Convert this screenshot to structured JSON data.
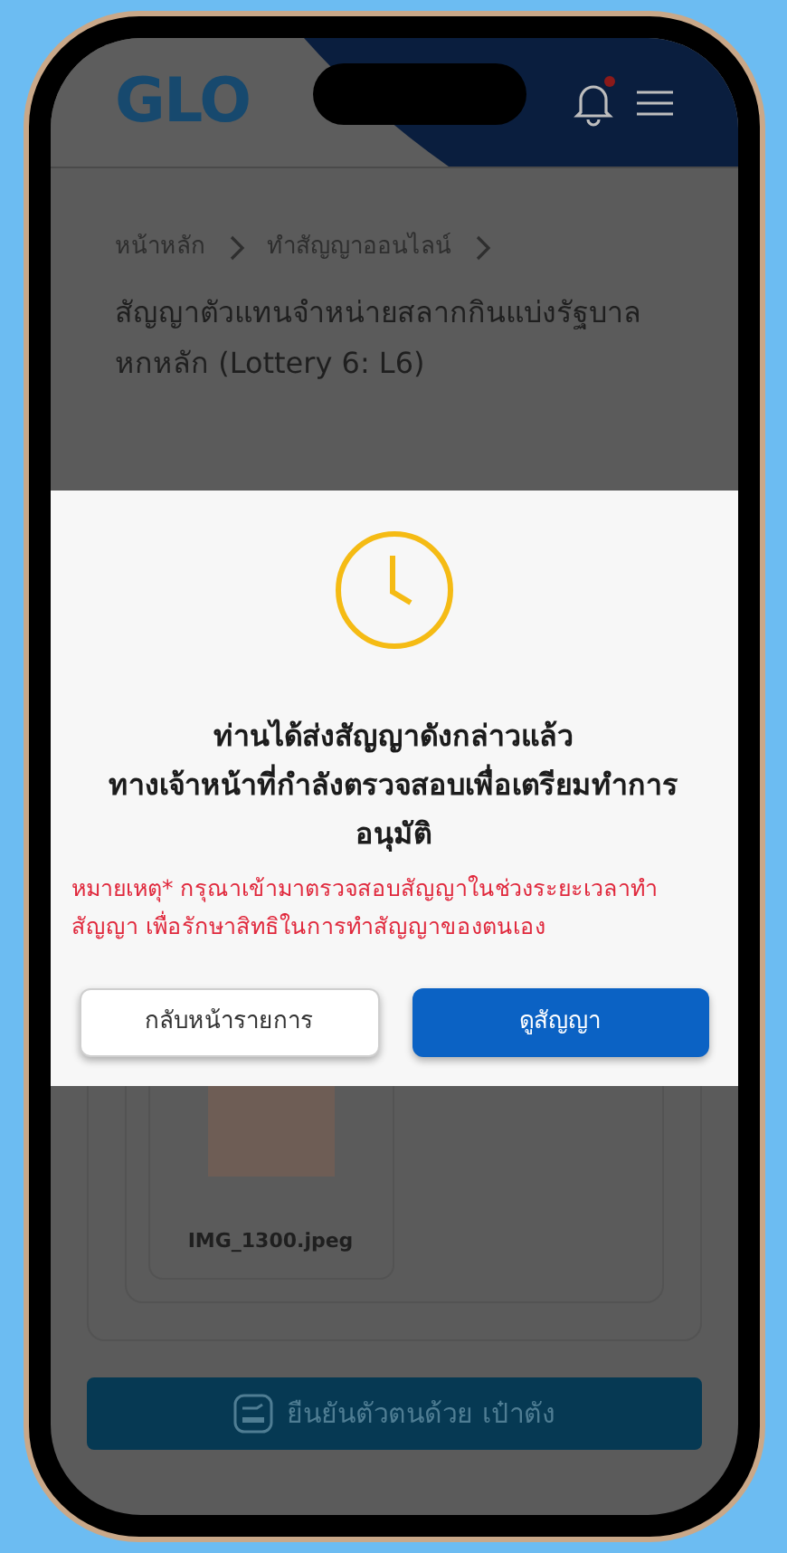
{
  "header": {
    "logo": "GLO",
    "has_notification": true
  },
  "breadcrumb": [
    "หน้าหลัก",
    "ทำสัญญาออนไลน์"
  ],
  "title": "สัญญาตัวแทนจำหน่ายสลากกินแบ่งรัฐบาล หกหลัก (Lottery 6: L6)",
  "attachment": {
    "file_name": "IMG_1300.jpeg"
  },
  "verify_button": {
    "label": "ยืนยันตัวตนด้วย เป๋าตัง"
  },
  "dialog": {
    "message": "ท่านได้ส่งสัญญาดังกล่าวแล้ว\nทางเจ้าหน้าที่กำลังตรวจสอบเพื่อเตรียมทำการอนุมัติ",
    "note": "หมายเหตุ* กรุณาเข้ามาตรวจสอบสัญญาในช่วงระยะเวลาทำสัญญา เพื่อรักษาสิทธิในการทำสัญญาของตนเอง",
    "buttons": [
      {
        "label": "กลับหน้ารายการ",
        "kind": "secondary"
      },
      {
        "label": "ดูสัญญา",
        "kind": "primary"
      }
    ]
  }
}
